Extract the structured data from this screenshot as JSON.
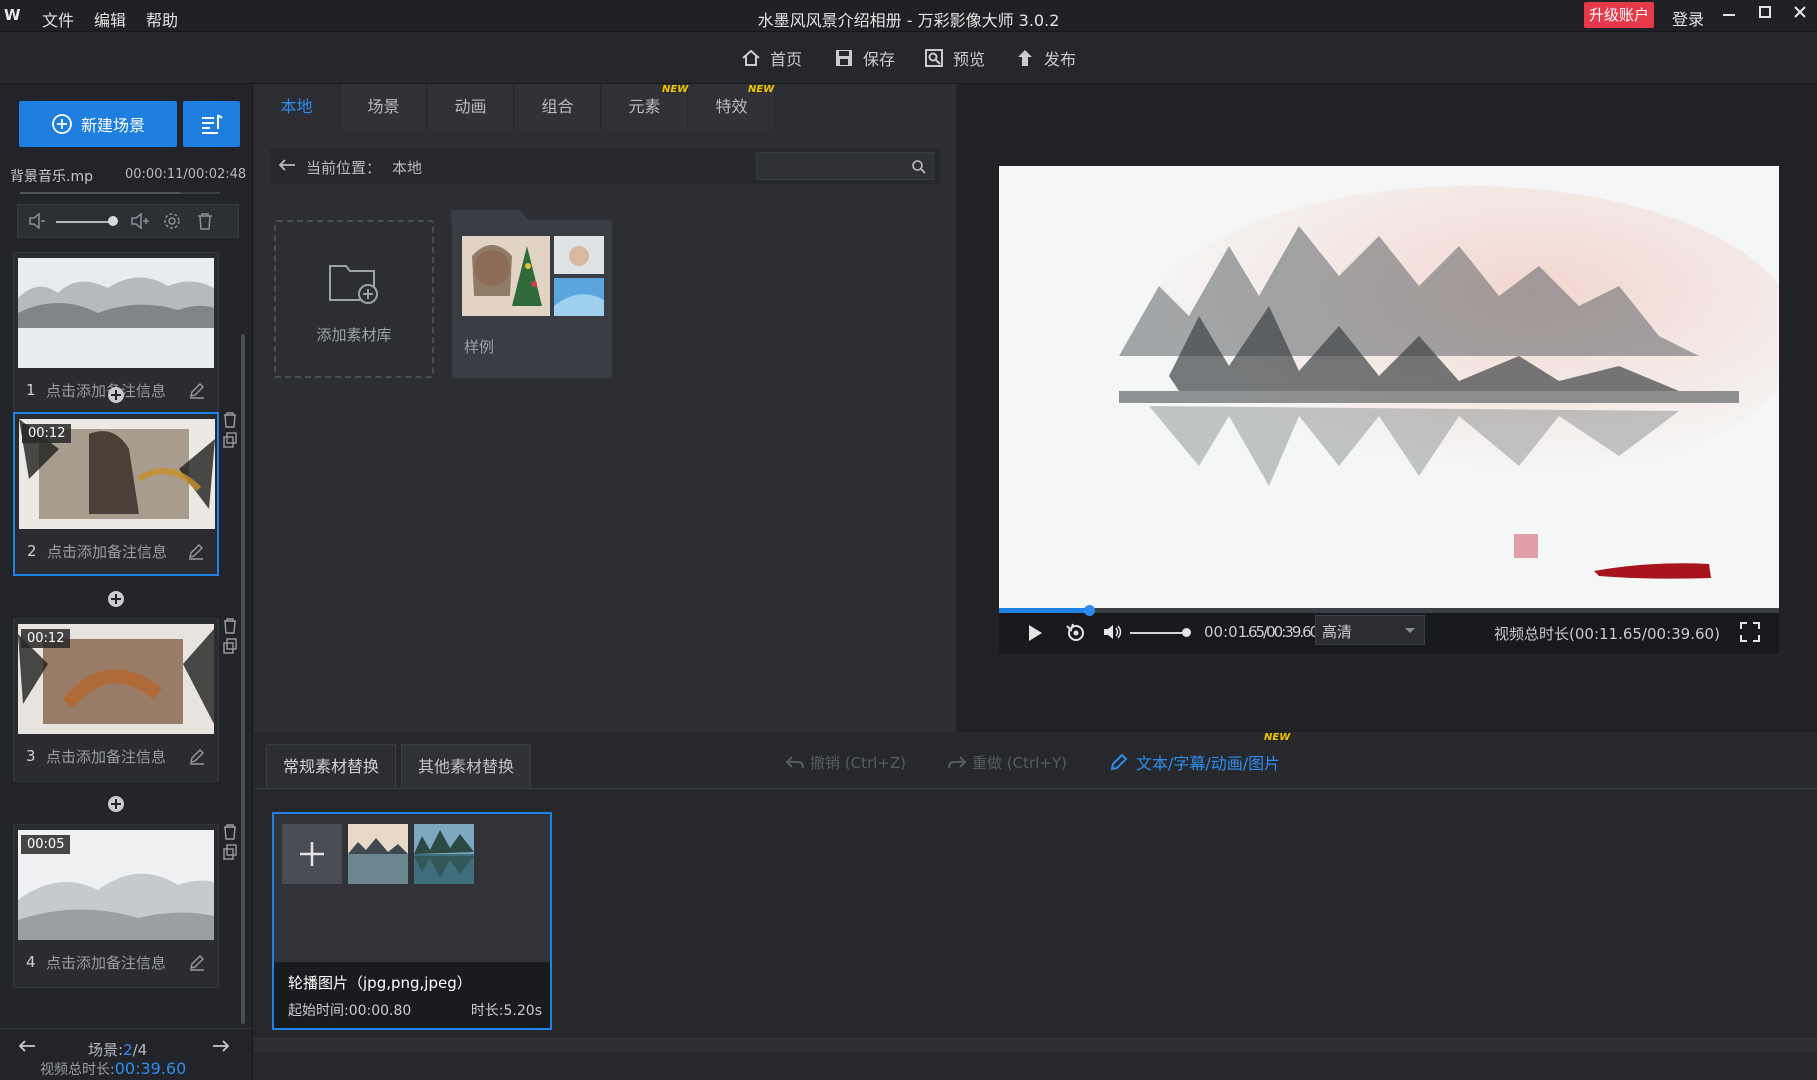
{
  "app": {
    "logo": "W",
    "title": "水墨风风景介绍相册 - 万彩影像大师 3.0.2",
    "menu": [
      "文件",
      "编辑",
      "帮助"
    ],
    "upgrade": "升级账户",
    "login": "登录"
  },
  "toolbar": {
    "home": "首页",
    "save": "保存",
    "preview": "预览",
    "publish": "发布"
  },
  "left": {
    "new_scene": "新建场景",
    "music_name": "背景音乐.mp",
    "music_time": "00:00:11/00:02:48",
    "scenes": [
      {
        "index": "1",
        "duration": "",
        "note": "点击添加备注信息"
      },
      {
        "index": "2",
        "duration": "00:12",
        "note": "点击添加备注信息"
      },
      {
        "index": "3",
        "duration": "00:12",
        "note": "点击添加备注信息"
      },
      {
        "index": "4",
        "duration": "00:05",
        "note": "点击添加备注信息"
      }
    ],
    "footer_scene_label": "场景:",
    "footer_scene_current": "2",
    "footer_scene_total": "/4",
    "footer_duration_label": "视频总时长:",
    "footer_duration": "00:39.60"
  },
  "library": {
    "tabs": [
      "本地",
      "场景",
      "动画",
      "组合",
      "元素",
      "特效"
    ],
    "new_badge": "NEW",
    "path_label": "当前位置：",
    "path_value": "本地",
    "search_placeholder": "",
    "add_library": "添加素材库",
    "sample": "样例"
  },
  "player": {
    "time_current": "00:0",
    "time_overlay": "1.65/00:39.60",
    "quality": "高清",
    "total_duration": "视频总时长(00:11.65/00:39.60)",
    "progress_fraction": 0.115
  },
  "bottom": {
    "tab_common": "常规素材替换",
    "tab_other": "其他素材替换",
    "undo": "撤销 (Ctrl+Z)",
    "redo": "重做 (Ctrl+Y)",
    "text_link": "文本/字幕/动画/图片",
    "card_title": "轮播图片（jpg,png,jpeg）",
    "card_start": "起始时间:00:00.80",
    "card_duration": "时长:5.20s"
  },
  "colors": {
    "accent": "#1e7fe0",
    "upgrade": "#e8394a",
    "badge": "#f2c500"
  }
}
